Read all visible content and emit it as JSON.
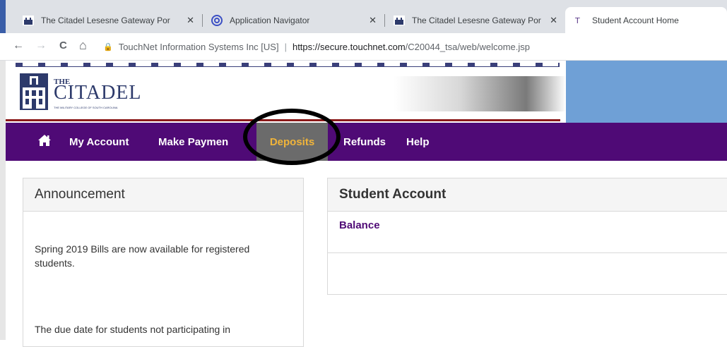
{
  "browser": {
    "tabs": [
      {
        "title": "The Citadel Lesesne Gateway Por",
        "icon": "citadel-favicon",
        "active": false
      },
      {
        "title": "Application Navigator",
        "icon": "navigator-favicon",
        "active": false
      },
      {
        "title": "The Citadel Lesesne Gateway Por",
        "icon": "citadel-favicon",
        "active": false
      },
      {
        "title": "Student Account Home",
        "icon": "touchnet-favicon",
        "active": true
      }
    ],
    "close_glyph": "✕",
    "back_glyph": "←",
    "forward_glyph": "→",
    "reload_glyph": "C",
    "home_glyph": "⌂",
    "lock_glyph": "🔒",
    "site_identity": "TouchNet Information Systems Inc [US]",
    "url_host": "https://secure.touchnet.com",
    "url_path": "/C20044_tsa/web/welcome.jsp"
  },
  "header": {
    "logo_the": "THE",
    "logo_name": "CITADEL",
    "logo_sub": "THE MILITARY COLLEGE OF SOUTH CAROLINA"
  },
  "nav": {
    "home_icon": "home-icon",
    "items": [
      {
        "label": "My Account"
      },
      {
        "label": "Make Paymen"
      },
      {
        "label": "Deposits",
        "active": true
      },
      {
        "label": "Refunds"
      },
      {
        "label": "Help"
      }
    ]
  },
  "announcement": {
    "title": "Announcement",
    "paragraphs": [
      "Spring 2019 Bills are now available for registered students.",
      "The due date for students not participating in"
    ]
  },
  "student_account": {
    "title": "Student Account",
    "balance_label": "Balance"
  },
  "colors": {
    "nav_bg": "#4f0a76",
    "active_nav_bg": "#6b6b6b",
    "active_nav_text": "#f0b43a",
    "header_blue": "#6fa0d6"
  }
}
